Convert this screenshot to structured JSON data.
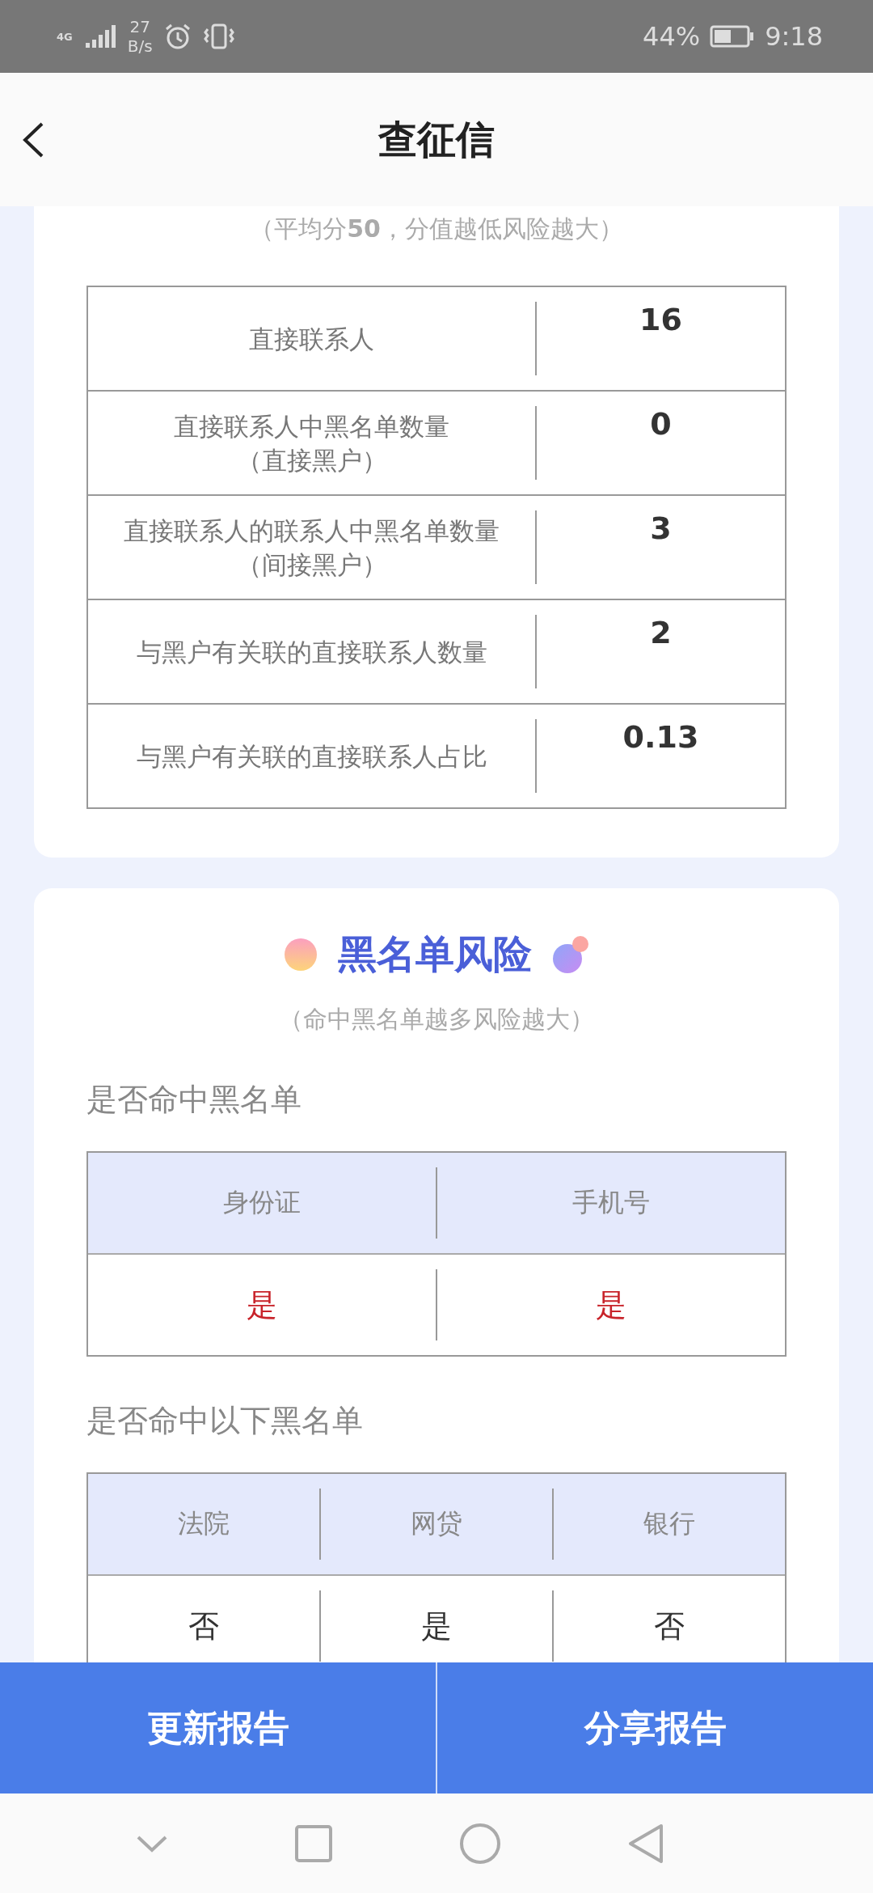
{
  "status_bar": {
    "network": "4G",
    "speed_value": "27",
    "speed_unit": "B/s",
    "battery": "44%",
    "time": "9:18"
  },
  "header": {
    "title": "查征信"
  },
  "contacts_card": {
    "subtitle": "（平均分**50**，分值越低风险越大）",
    "rows": [
      {
        "label": [
          "直接联系人"
        ],
        "value": "16"
      },
      {
        "label": [
          "直接联系人中黑名单数量",
          "（直接黑户）"
        ],
        "value": "0"
      },
      {
        "label": [
          "直接联系人的联系人中黑名单数量",
          "（间接黑户）"
        ],
        "value": "3"
      },
      {
        "label": [
          "与黑户有关联的直接联系人数量"
        ],
        "value": "2"
      },
      {
        "label": [
          "与黑户有关联的直接联系人占比"
        ],
        "value": "0.13"
      }
    ]
  },
  "blacklist_card": {
    "title": "黑名单风险",
    "subtitle": "（命中黑名单越多风险越大）",
    "sections": [
      {
        "heading": "是否命中黑名单",
        "columns": [
          "身份证",
          "手机号"
        ],
        "values": [
          {
            "text": "是",
            "alert": true
          },
          {
            "text": "是",
            "alert": true
          }
        ]
      },
      {
        "heading": "是否命中以下黑名单",
        "columns": [
          "法院",
          "网贷",
          "银行"
        ],
        "values": [
          {
            "text": "否",
            "alert": false
          },
          {
            "text": "是",
            "alert": false
          },
          {
            "text": "否",
            "alert": false
          }
        ]
      }
    ]
  },
  "buttons": [
    "更新报告",
    "分享报告"
  ]
}
